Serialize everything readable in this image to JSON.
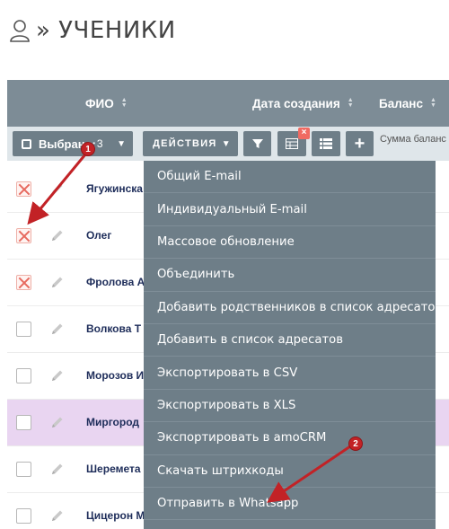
{
  "header": {
    "title": "» УЧЕНИКИ",
    "user_icon": "user-icon"
  },
  "table": {
    "columns": [
      {
        "label": "ФИО"
      },
      {
        "label": "Дата создания"
      },
      {
        "label": "Баланс"
      }
    ]
  },
  "toolbar": {
    "selected_label": "Выбрано:",
    "selected_count": "3",
    "actions_label": "ДЕЙСТВИЯ",
    "sum_text": "Сумма баланс",
    "filter_icon": "filter-icon",
    "columns_icon": "table-columns-icon",
    "list_icon": "list-icon",
    "add_label": "+",
    "close_badge": "×"
  },
  "rows": [
    {
      "name": "Ягужинска",
      "checked": true
    },
    {
      "name": "Олег",
      "checked": true
    },
    {
      "name": "Фролова А",
      "checked": true
    },
    {
      "name": "Волкова Т",
      "checked": false
    },
    {
      "name": "Морозов И",
      "checked": false
    },
    {
      "name": "Миргород",
      "checked": false,
      "highlighted": true
    },
    {
      "name": "Шеремета",
      "checked": false
    },
    {
      "name": "Цицерон М",
      "checked": false
    }
  ],
  "actions_menu": [
    "Общий E-mail",
    "Индивидуальный E-mail",
    "Массовое обновление",
    "Объединить",
    "Добавить родственников в список адресатов",
    "Добавить в список адресатов",
    "Экспортировать в CSV",
    "Экспортировать в XLS",
    "Экспортировать в amoCRM",
    "Скачать штрихкоды",
    "Отправить в Whatsapp"
  ],
  "annotations": {
    "marker_1": "1",
    "marker_2": "2",
    "color": "#c22226"
  },
  "colors": {
    "header_bg": "#7d8c96",
    "toolbar_bg": "#dfe6ea",
    "button_bg": "#6e7e88",
    "highlight_row": "#e9d5f1",
    "check_red": "#e76a5f"
  }
}
